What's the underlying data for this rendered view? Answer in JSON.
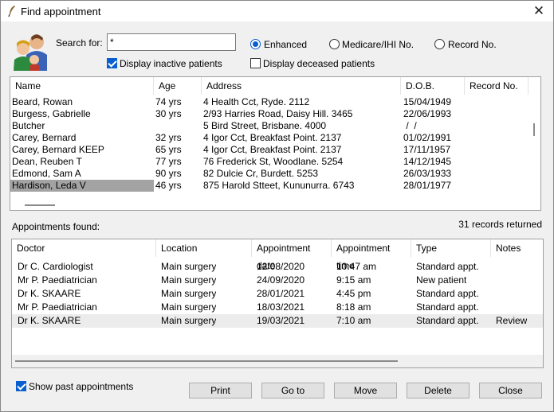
{
  "window": {
    "title": "Find appointment",
    "close_glyph": "✕"
  },
  "search": {
    "label": "Search for:",
    "value": "*",
    "modes": [
      {
        "label": "Enhanced",
        "selected": true
      },
      {
        "label": "Medicare/IHI No.",
        "selected": false
      },
      {
        "label": "Record No.",
        "selected": false
      }
    ],
    "display_inactive": {
      "label": "Display inactive patients",
      "checked": true
    },
    "display_deceased": {
      "label": "Display deceased patients",
      "checked": false
    }
  },
  "patients": {
    "columns": [
      "Name",
      "Age",
      "Address",
      "D.O.B.",
      "Record No."
    ],
    "rows": [
      [
        "Beard, Rowan",
        "74 yrs",
        "4 Health Cct, Ryde. 2112",
        "15/04/1949",
        ""
      ],
      [
        "Burgess, Gabrielle",
        "30 yrs",
        "2/93 Harries Road, Daisy Hill. 3465",
        "22/06/1993",
        ""
      ],
      [
        "Butcher",
        "",
        "5 Bird Street, Brisbane. 4000",
        " /  /",
        ""
      ],
      [
        "Carey, Bernard",
        "32 yrs",
        "4 Igor Cct, Breakfast Point. 2137",
        "01/02/1991",
        ""
      ],
      [
        "Carey, Bernard KEEP",
        "65 yrs",
        "4 Igor Cct, Breakfast Point. 2137",
        "17/11/1957",
        ""
      ],
      [
        "Dean, Reuben T",
        "77 yrs",
        "76 Frederick St, Woodlane. 5254",
        "14/12/1945",
        ""
      ],
      [
        "Edmond, Sam A",
        "90 yrs",
        "82 Dulcie Cr, Burdett. 5253",
        "26/03/1933",
        ""
      ],
      [
        "Hardison, Leda V",
        "46 yrs",
        "875 Harold Stteet, Kununurra. 6743",
        "28/01/1977",
        ""
      ]
    ],
    "selected_index": 7
  },
  "appointments": {
    "label": "Appointments found:",
    "count_text": "31 records returned",
    "columns": [
      "Doctor",
      "Location",
      "Appointment date",
      "Appointment time",
      "Type",
      "Notes"
    ],
    "rows": [
      [
        "Dr C. Cardiologist",
        "Main surgery",
        "12/08/2020",
        "10:47 am",
        "Standard appt.",
        ""
      ],
      [
        "Mr P. Paediatrician",
        "Main surgery",
        "24/09/2020",
        "9:15 am",
        "New patient",
        ""
      ],
      [
        "Dr K. SKAARE",
        "Main surgery",
        "28/01/2021",
        "4:45 pm",
        "Standard appt.",
        ""
      ],
      [
        "Mr P. Paediatrician",
        "Main surgery",
        "18/03/2021",
        "8:18 am",
        "Standard appt.",
        ""
      ],
      [
        "Dr K. SKAARE",
        "Main surgery",
        "19/03/2021",
        "7:10 am",
        "Standard appt.",
        "Review"
      ]
    ],
    "selected_index": 4
  },
  "footer": {
    "show_past": {
      "label": "Show past appointments",
      "checked": true
    },
    "buttons": [
      "Print",
      "Go to",
      "Move",
      "Delete",
      "Close"
    ]
  },
  "colors": {
    "accent": "#0a5fd0",
    "selected_patient": "#a3a3a3",
    "selected_appt": "#ececec"
  }
}
